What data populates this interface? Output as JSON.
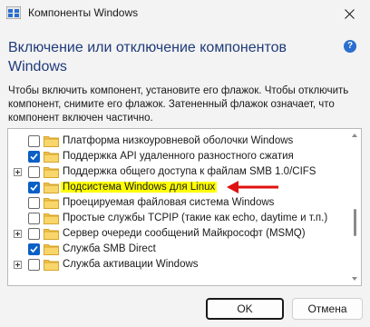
{
  "window": {
    "title": "Компоненты Windows",
    "icon": "windows-features-icon"
  },
  "heading": "Включение или отключение компонентов Windows",
  "description": "Чтобы включить компонент, установите его флажок. Чтобы отключить компонент, снимите его флажок. Затененный флажок означает, что компонент включен частично.",
  "features": [
    {
      "label": "Платформа низкоуровневой оболочки Windows",
      "checked": false,
      "expandable": false
    },
    {
      "label": "Поддержка API удаленного разностного сжатия",
      "checked": true,
      "expandable": false
    },
    {
      "label": "Поддержка общего доступа к файлам SMB 1.0/CIFS",
      "checked": false,
      "expandable": true
    },
    {
      "label": "Подсистема Windows для Linux",
      "checked": true,
      "expandable": false,
      "highlighted": true
    },
    {
      "label": "Проецируемая файловая система Windows",
      "checked": false,
      "expandable": false
    },
    {
      "label": "Простые службы TCPIP (такие как echo, daytime и т.п.)",
      "checked": false,
      "expandable": false
    },
    {
      "label": "Сервер очереди сообщений Майкрософт (MSMQ)",
      "checked": false,
      "expandable": true
    },
    {
      "label": "Служба SMB Direct",
      "checked": true,
      "expandable": false
    },
    {
      "label": "Служба активации Windows",
      "checked": false,
      "expandable": true
    }
  ],
  "buttons": {
    "ok": "OK",
    "cancel": "Отмена"
  },
  "colors": {
    "heading": "#1f3b7a",
    "highlight": "#ffff00",
    "arrow": "#e01010",
    "checkbox_checked": "#0a5fc5"
  }
}
